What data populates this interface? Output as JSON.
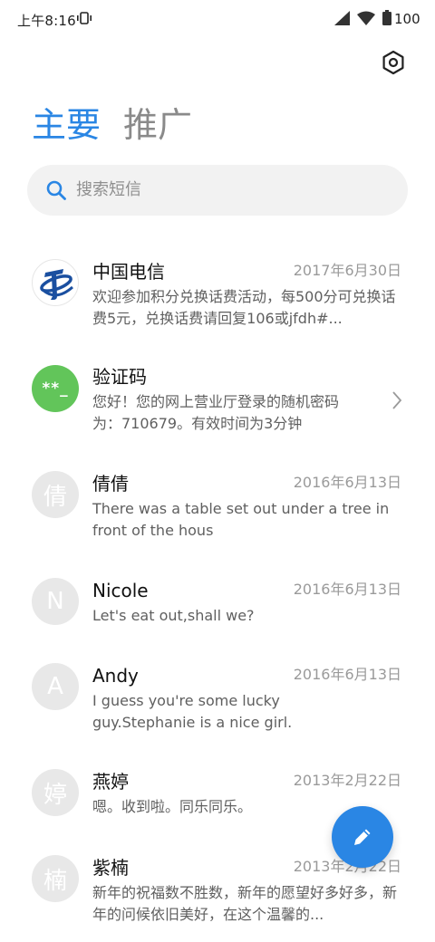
{
  "status_bar": {
    "time": "上午8:16",
    "battery": "100"
  },
  "header": {
    "settings_icon": "settings-hexagon-icon",
    "tabs": [
      {
        "label": "主要",
        "active": true
      },
      {
        "label": "推广",
        "active": false
      }
    ]
  },
  "search": {
    "placeholder": "搜索短信"
  },
  "messages": [
    {
      "sender": "中国电信",
      "date": "2017年6月30日",
      "preview": "欢迎参加积分兑换话费活动，每500分可兑换话费5元，兑换话费请回复106或jfdh#...",
      "avatar": "china-telecom-logo"
    },
    {
      "sender": "验证码",
      "date": "",
      "preview": "您好！您的网上营业厅登录的随机密码为：710679。有效时间为3分钟",
      "avatar": "**_"
    },
    {
      "sender": "倩倩",
      "date": "2016年6月13日",
      "preview": "There was a table set out under a tree in front of the hous",
      "avatar": "倩"
    },
    {
      "sender": "Nicole",
      "date": "2016年6月13日",
      "preview": "Let's eat out,shall we?",
      "avatar": "N"
    },
    {
      "sender": "Andy",
      "date": "2016年6月13日",
      "preview": "I guess you're some lucky guy.Stephanie is a nice girl.",
      "avatar": "A"
    },
    {
      "sender": "燕婷",
      "date": "2013年2月22日",
      "preview": "嗯。收到啦。同乐同乐。",
      "avatar": "婷"
    },
    {
      "sender": "紫楠",
      "date": "2013年2月22日",
      "preview": "新年的祝福数不胜数，新年的愿望好多好多，新年的问候依旧美好，在这个温馨的...",
      "avatar": "楠"
    }
  ],
  "fab": {
    "icon": "compose-pencil-icon",
    "color": "#2a86e4"
  },
  "colors": {
    "accent": "#2a86e4",
    "verification_avatar": "#62c55a"
  }
}
